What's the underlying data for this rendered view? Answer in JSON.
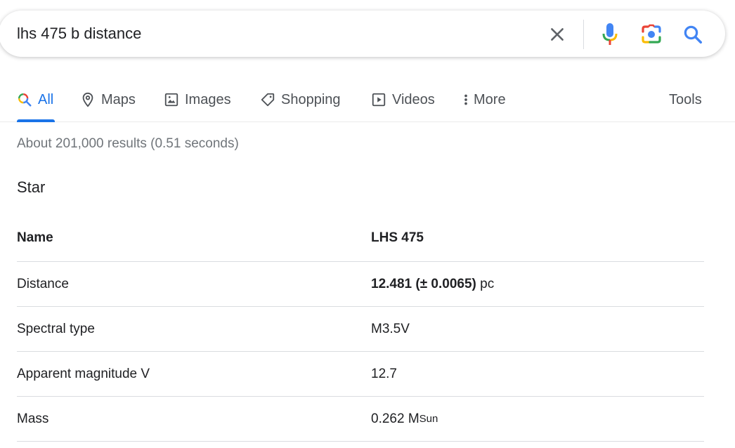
{
  "search": {
    "query": "lhs 475 b distance"
  },
  "tabs": [
    {
      "label": "All",
      "icon": "search-multicolor-icon",
      "active": true
    },
    {
      "label": "Maps",
      "icon": "map-pin-icon"
    },
    {
      "label": "Images",
      "icon": "image-icon"
    },
    {
      "label": "Shopping",
      "icon": "tag-icon"
    },
    {
      "label": "Videos",
      "icon": "play-icon"
    },
    {
      "label": "More",
      "icon": "more-vert-icon"
    }
  ],
  "tools_label": "Tools",
  "result_stats": "About 201,000 results (0.51 seconds)",
  "section_title": "Star",
  "info": {
    "name": {
      "label": "Name",
      "value": "LHS 475"
    },
    "distance": {
      "label": "Distance",
      "value_bold": "12.481 (± 0.0065)",
      "unit": "pc"
    },
    "spectral_type": {
      "label": "Spectral type",
      "value": "M3.5V"
    },
    "apparent_magnitude": {
      "label": "Apparent magnitude V",
      "value": "12.7"
    },
    "mass": {
      "label": "Mass",
      "value": "0.262 M",
      "subscript": "Sun"
    }
  },
  "colors": {
    "accent": "#1a73e8",
    "text": "#202124",
    "muted": "#70757a",
    "google_blue": "#4285F4",
    "google_red": "#EA4335",
    "google_yellow": "#FBBC04",
    "google_green": "#34A853"
  }
}
